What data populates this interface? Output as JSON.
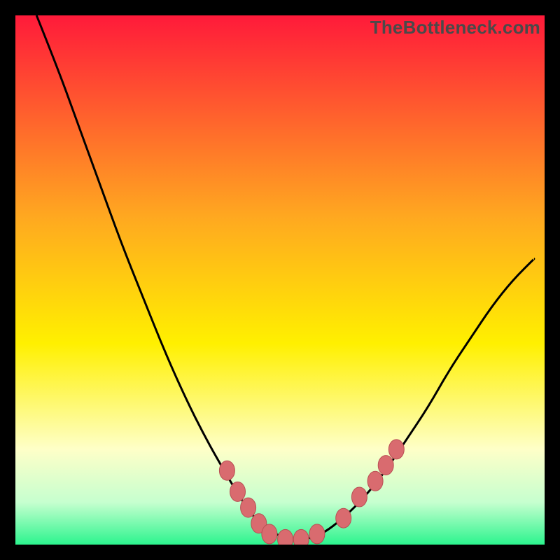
{
  "watermark": "TheBottleneck.com",
  "colors": {
    "red": "#ff1a3a",
    "orange": "#ffa820",
    "yellow": "#fff000",
    "pale": "#feffc8",
    "mint": "#c6ffcf",
    "green": "#2cf48e",
    "curve": "#000000",
    "bead_fill": "#d96b6f",
    "bead_stroke": "#b94e53",
    "bg": "#000000"
  },
  "gradient_stops": [
    {
      "offset": 0.0,
      "key": "red"
    },
    {
      "offset": 0.38,
      "key": "orange"
    },
    {
      "offset": 0.62,
      "key": "yellow"
    },
    {
      "offset": 0.82,
      "key": "pale"
    },
    {
      "offset": 0.92,
      "key": "mint"
    },
    {
      "offset": 1.0,
      "key": "green"
    }
  ],
  "chart_data": {
    "type": "line",
    "title": "",
    "xlabel": "",
    "ylabel": "",
    "xlim": [
      0,
      100
    ],
    "ylim": [
      0,
      100
    ],
    "x": [
      4,
      8,
      12,
      16,
      20,
      24,
      28,
      32,
      36,
      40,
      43,
      46,
      49,
      52,
      55,
      58,
      62,
      66,
      70,
      74,
      78,
      82,
      86,
      90,
      94,
      98
    ],
    "y": [
      100,
      90,
      79,
      68,
      57,
      47,
      37,
      28,
      20,
      13,
      8,
      4,
      2,
      1,
      1,
      2,
      5,
      9,
      14,
      20,
      26,
      33,
      39,
      45,
      50,
      54
    ],
    "beads": [
      {
        "x": 40,
        "y": 14
      },
      {
        "x": 42,
        "y": 10
      },
      {
        "x": 44,
        "y": 7
      },
      {
        "x": 46,
        "y": 4
      },
      {
        "x": 48,
        "y": 2
      },
      {
        "x": 51,
        "y": 1
      },
      {
        "x": 54,
        "y": 1
      },
      {
        "x": 57,
        "y": 2
      },
      {
        "x": 62,
        "y": 5
      },
      {
        "x": 65,
        "y": 9
      },
      {
        "x": 68,
        "y": 12
      },
      {
        "x": 70,
        "y": 15
      },
      {
        "x": 72,
        "y": 18
      }
    ]
  }
}
